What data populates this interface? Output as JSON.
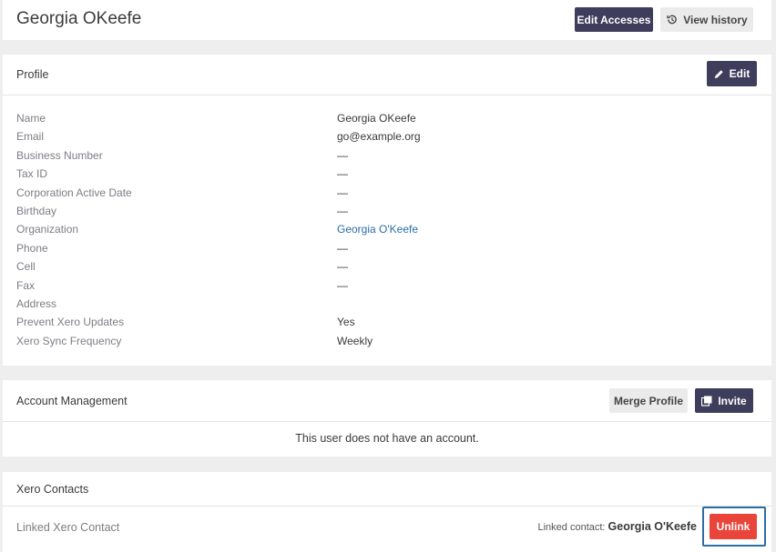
{
  "header": {
    "title": "Georgia OKeefe",
    "edit_accesses_label": "Edit Accesses",
    "view_history_label": "View history",
    "history_icon": "history-icon"
  },
  "profile": {
    "title": "Profile",
    "edit_label": "Edit",
    "edit_icon": "pencil-icon",
    "rows": [
      {
        "label": "Name",
        "value": "Georgia OKeefe"
      },
      {
        "label": "Email",
        "value": "go@example.org"
      },
      {
        "label": "Business Number",
        "value": "—"
      },
      {
        "label": "Tax ID",
        "value": "—"
      },
      {
        "label": "Corporation Active Date",
        "value": "—"
      },
      {
        "label": "Birthday",
        "value": "—"
      },
      {
        "label": "Organization",
        "value": "Georgia O'Keefe"
      },
      {
        "label": "Phone",
        "value": "—"
      },
      {
        "label": "Cell",
        "value": "—"
      },
      {
        "label": "Fax",
        "value": "—"
      },
      {
        "label": "Address",
        "value": ""
      },
      {
        "label": "Prevent Xero Updates",
        "value": "Yes"
      },
      {
        "label": "Xero Sync Frequency",
        "value": "Weekly"
      }
    ]
  },
  "account": {
    "title": "Account Management",
    "merge_label": "Merge Profile",
    "invite_label": "Invite",
    "invite_icon": "invite-icon",
    "empty_message": "This user does not have an account."
  },
  "xero": {
    "title": "Xero Contacts",
    "linked_label": "Linked Xero Contact",
    "linked_prefix": "Linked contact:",
    "linked_name": "Georgia O'Keefe",
    "unlink_label": "Unlink"
  },
  "colors": {
    "primary": "#3f3d5c",
    "danger": "#e9453b",
    "link": "#2c6ea5",
    "background": "#eeeeef"
  }
}
